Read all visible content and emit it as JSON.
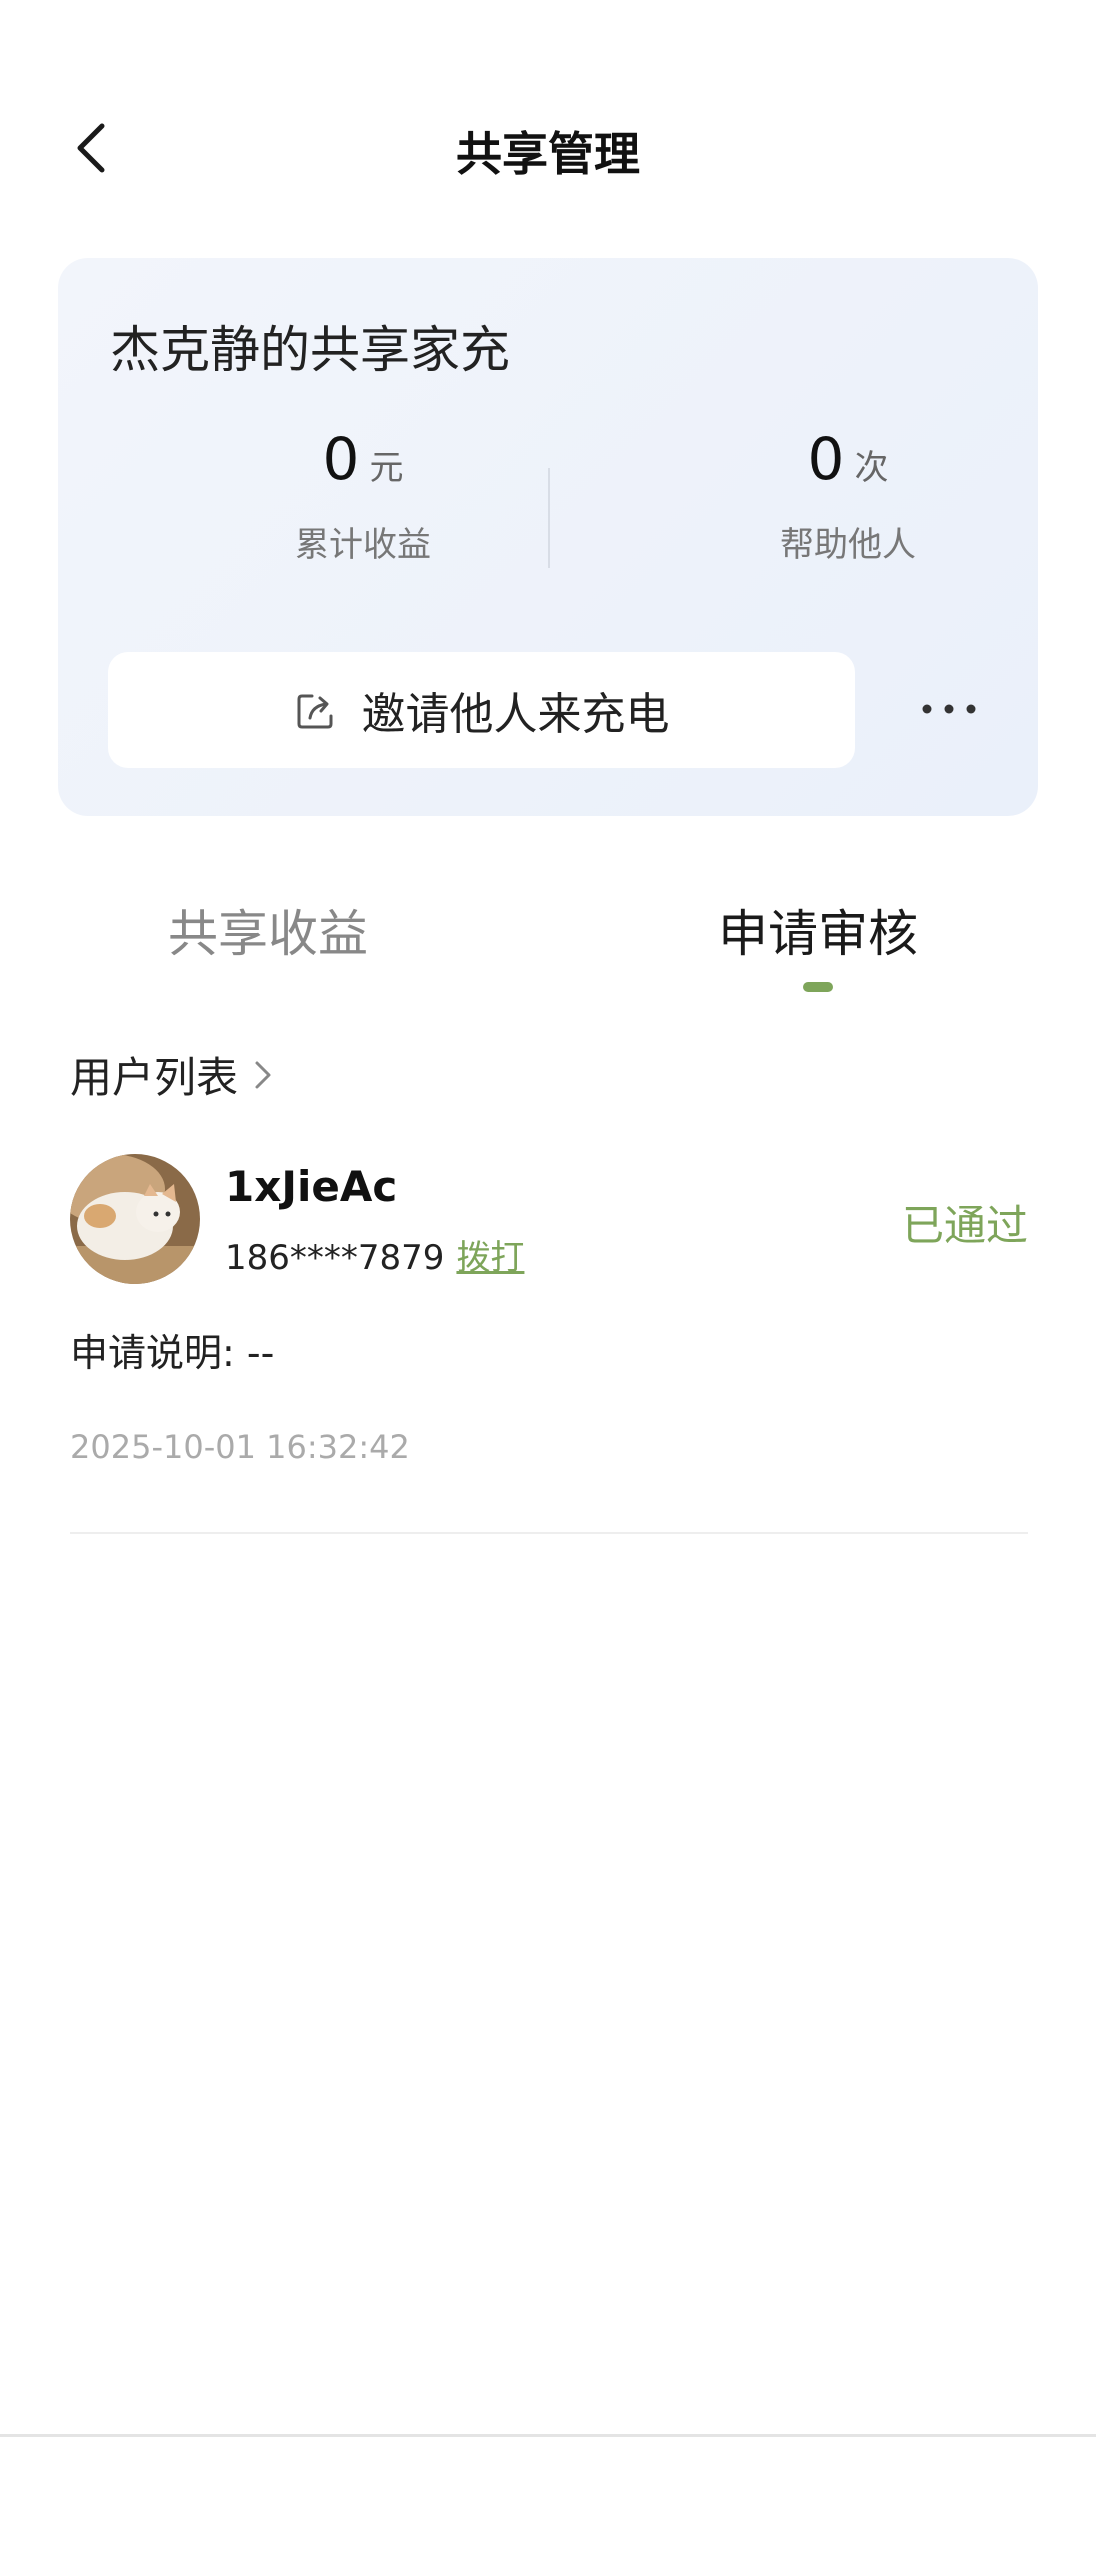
{
  "header": {
    "title": "共享管理",
    "back_icon": "chevron-left-icon"
  },
  "card": {
    "title": "杰克静的共享家充",
    "earnings": {
      "value": "0",
      "unit": "元",
      "label": "累计收益"
    },
    "helped": {
      "value": "0",
      "unit": "次",
      "label": "帮助他人"
    },
    "invite_label": "邀请他人来充电",
    "invite_icon": "share-icon",
    "more_icon": "more-dots-icon"
  },
  "tabs": [
    {
      "label": "共享收益",
      "active": false
    },
    {
      "label": "申请审核",
      "active": true
    }
  ],
  "user_list": {
    "label": "用户列表"
  },
  "records": [
    {
      "username": "1xJieAc",
      "phone": "186****7879",
      "call_label": "拨打",
      "status": "已通过",
      "description": "申请说明: --",
      "timestamp": "2025-10-01 16:32:42"
    }
  ],
  "colors": {
    "accent": "#7ea55a",
    "card_bg": "#eef2f9"
  }
}
